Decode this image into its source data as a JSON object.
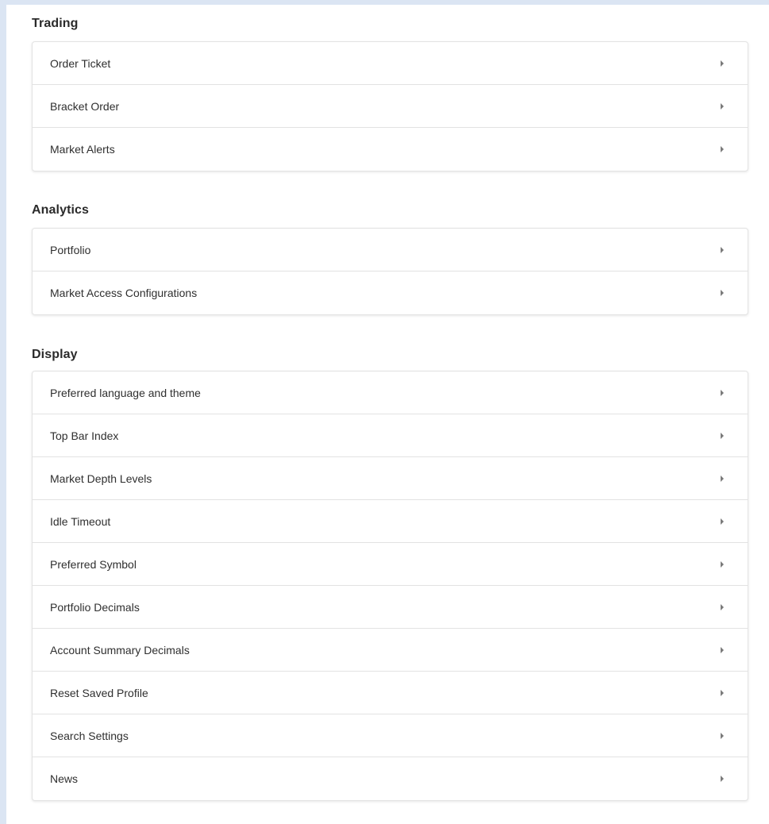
{
  "sections": [
    {
      "title": "Trading",
      "items": [
        "Order Ticket",
        "Bracket Order",
        "Market Alerts"
      ]
    },
    {
      "title": "Analytics",
      "items": [
        "Portfolio",
        "Market Access Configurations"
      ]
    },
    {
      "title": "Display",
      "items": [
        "Preferred language and theme",
        "Top Bar Index",
        "Market Depth Levels",
        "Idle Timeout",
        "Preferred Symbol",
        "Portfolio Decimals",
        "Account Summary Decimals",
        "Reset Saved Profile",
        "Search Settings",
        "News"
      ]
    }
  ],
  "icons": {
    "row_chevron": "chevron-right-icon"
  },
  "colors": {
    "page_background": "#dbe5f3",
    "panel_background": "#ffffff",
    "text": "#2f2f2f",
    "divider": "#e2e2e2"
  }
}
